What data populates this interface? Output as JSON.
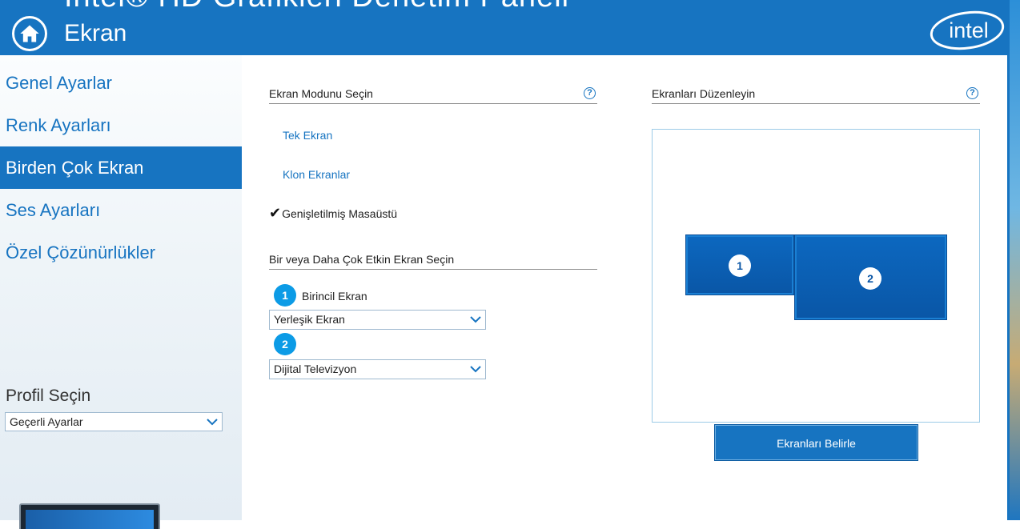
{
  "header": {
    "app_title": "Intel® HD Grafikleri Denetim Paneli",
    "page_title": "Ekran",
    "brand_logo_text": "intel",
    "color": "#1774c1"
  },
  "sidebar": {
    "items": [
      {
        "label": "Genel Ayarlar",
        "active": false
      },
      {
        "label": "Renk Ayarları",
        "active": false
      },
      {
        "label": "Birden Çok Ekran",
        "active": true
      },
      {
        "label": "Ses Ayarları",
        "active": false
      },
      {
        "label": "Özel Çözünürlükler",
        "active": false
      }
    ],
    "profile": {
      "label": "Profil Seçin",
      "selected": "Geçerli Ayarlar"
    }
  },
  "main": {
    "mode_section": {
      "title": "Ekran Modunu Seçin",
      "help": "?",
      "options": [
        {
          "label": "Tek Ekran",
          "selected": false
        },
        {
          "label": "Klon Ekranlar",
          "selected": false
        },
        {
          "label": "Genişletilmiş Masaüstü",
          "selected": true
        }
      ],
      "check_mark": "✔"
    },
    "active_section": {
      "title": "Bir veya Daha Çok Etkin Ekran Seçin",
      "displays": [
        {
          "number": "1",
          "label": "Birincil Ekran",
          "selected": "Yerleşik Ekran"
        },
        {
          "number": "2",
          "label": "",
          "selected": "Dijital Televizyon"
        }
      ]
    },
    "arrange_section": {
      "title": "Ekranları Düzenleyin",
      "help": "?",
      "monitors": [
        {
          "number": "1"
        },
        {
          "number": "2"
        }
      ],
      "identify_button": "Ekranları Belirle"
    }
  }
}
